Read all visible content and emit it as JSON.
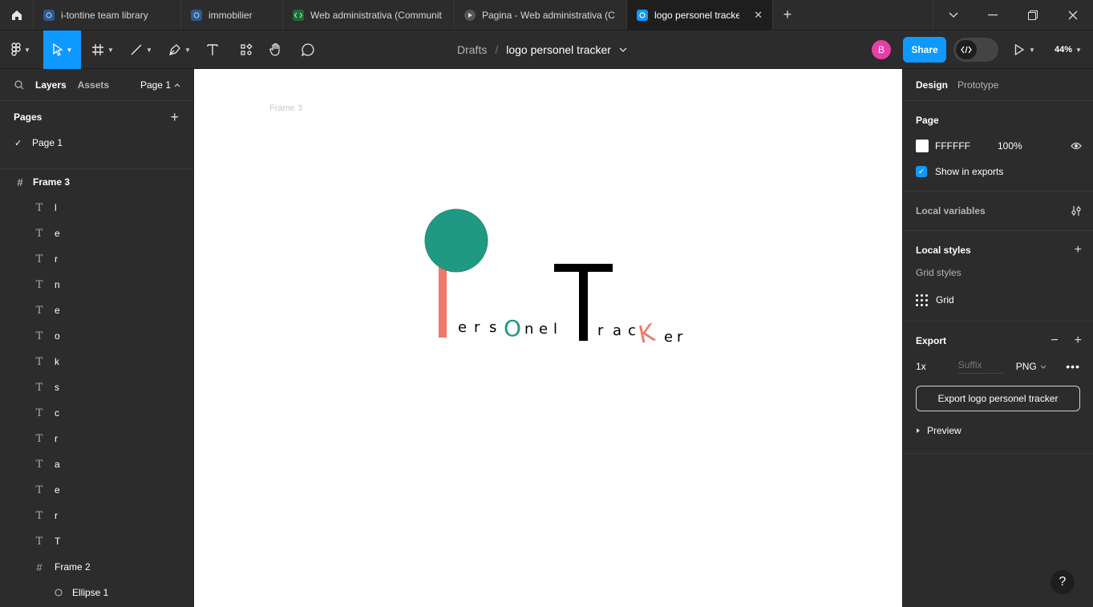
{
  "tabs": [
    {
      "label": "i-tontine team library",
      "icon": "figma-file-icon",
      "color": "#2d5a8a"
    },
    {
      "label": "immobilier",
      "icon": "figma-file-icon",
      "color": "#2d5a8a"
    },
    {
      "label": "Web administrativa (Communit",
      "icon": "dev-file-icon",
      "color": "#1f6b3a"
    },
    {
      "label": "Pagina - Web administrativa (C",
      "icon": "play-file-icon",
      "color": "#555555"
    },
    {
      "label": "logo personel tracker",
      "icon": "figma-file-icon",
      "color": "#0d99ff",
      "active": true
    }
  ],
  "breadcrumb": {
    "location": "Drafts",
    "separator": "/",
    "file": "logo personel tracker"
  },
  "toolbar": {
    "avatar_initial": "B",
    "share_label": "Share",
    "zoom": "44%"
  },
  "left_panel": {
    "tab_layers": "Layers",
    "tab_assets": "Assets",
    "page_selector": "Page 1",
    "pages_header": "Pages",
    "pages": [
      "Page 1"
    ],
    "layers": [
      {
        "name": "Frame 3",
        "kind": "frame",
        "depth": 0
      },
      {
        "name": "l",
        "kind": "text",
        "depth": 1
      },
      {
        "name": "e",
        "kind": "text",
        "depth": 1
      },
      {
        "name": "r",
        "kind": "text",
        "depth": 1
      },
      {
        "name": "n",
        "kind": "text",
        "depth": 1
      },
      {
        "name": "e",
        "kind": "text",
        "depth": 1
      },
      {
        "name": "o",
        "kind": "text",
        "depth": 1
      },
      {
        "name": "k",
        "kind": "text",
        "depth": 1
      },
      {
        "name": "s",
        "kind": "text",
        "depth": 1
      },
      {
        "name": "c",
        "kind": "text",
        "depth": 1
      },
      {
        "name": "r",
        "kind": "text",
        "depth": 1
      },
      {
        "name": "a",
        "kind": "text",
        "depth": 1
      },
      {
        "name": "e",
        "kind": "text",
        "depth": 1
      },
      {
        "name": "r",
        "kind": "text",
        "depth": 1
      },
      {
        "name": "T",
        "kind": "text",
        "depth": 1
      },
      {
        "name": "Frame 2",
        "kind": "frame",
        "depth": 1
      },
      {
        "name": "Ellipse 1",
        "kind": "ellipse",
        "depth": 2
      }
    ]
  },
  "canvas": {
    "frame_label": "Frame 3",
    "logo_letters_left": [
      "e",
      "r",
      "s",
      "O",
      "n",
      "e",
      "l"
    ],
    "logo_big_t": "T",
    "logo_letters_right": [
      "r",
      "a",
      "c",
      "K",
      "e",
      "r"
    ],
    "colors": {
      "teal": "#1f9982",
      "coral": "#f0776a",
      "black": "#000000"
    }
  },
  "right_panel": {
    "tab_design": "Design",
    "tab_prototype": "Prototype",
    "page_title": "Page",
    "page_color": "FFFFFF",
    "page_opacity": "100%",
    "show_in_exports": "Show in exports",
    "local_variables": "Local variables",
    "local_styles": "Local styles",
    "grid_styles": "Grid styles",
    "grid_label": "Grid",
    "export_title": "Export",
    "export_scale": "1x",
    "export_suffix_placeholder": "Suffix",
    "export_format": "PNG",
    "export_button": "Export logo personel tracker",
    "preview": "Preview"
  },
  "help": "?"
}
